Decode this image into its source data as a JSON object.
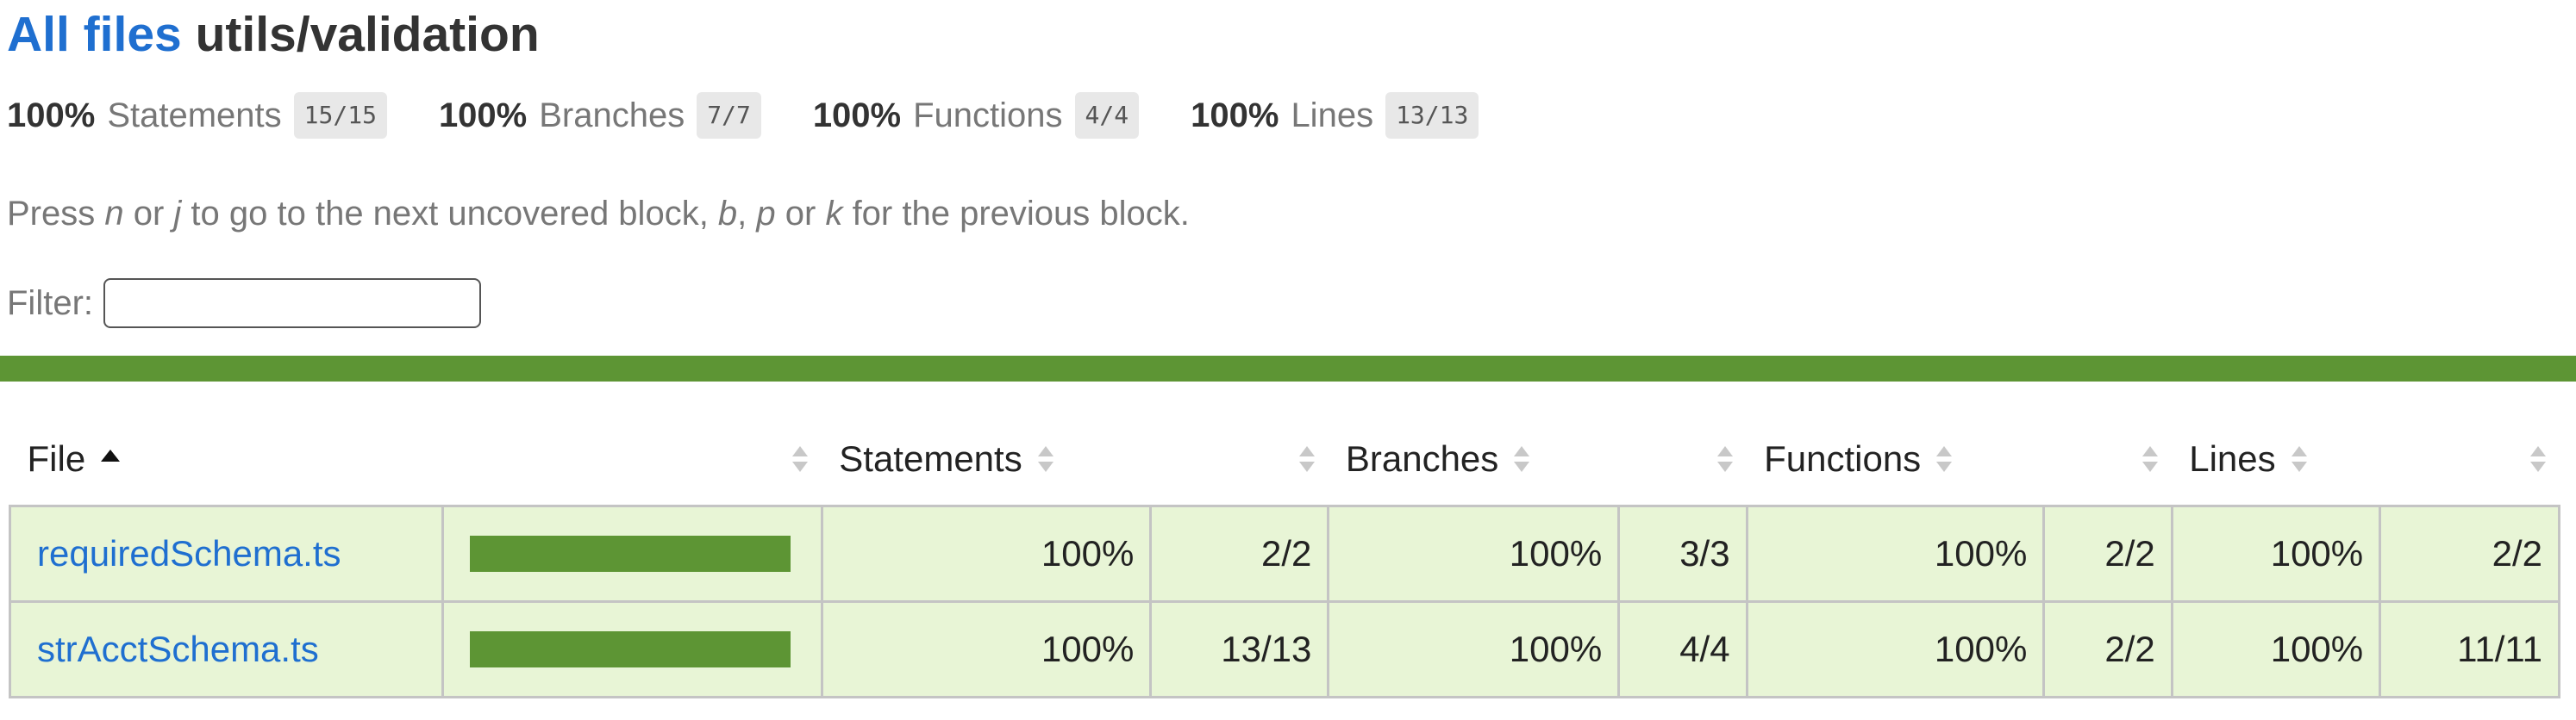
{
  "header": {
    "all_files_link": "All files",
    "path": "utils/validation"
  },
  "summary": [
    {
      "pct": "100%",
      "label": "Statements",
      "fraction": "15/15"
    },
    {
      "pct": "100%",
      "label": "Branches",
      "fraction": "7/7"
    },
    {
      "pct": "100%",
      "label": "Functions",
      "fraction": "4/4"
    },
    {
      "pct": "100%",
      "label": "Lines",
      "fraction": "13/13"
    }
  ],
  "help": {
    "t1": "Press ",
    "k1": "n",
    "t2": " or ",
    "k2": "j",
    "t3": " to go to the next uncovered block, ",
    "k3": "b",
    "t4": ", ",
    "k4": "p",
    "t5": " or ",
    "k5": "k",
    "t6": " for the previous block."
  },
  "filter": {
    "label": "Filter:",
    "value": "",
    "placeholder": ""
  },
  "status_color": "#5d9534",
  "table": {
    "headers": {
      "file": "File",
      "statements": "Statements",
      "branches": "Branches",
      "functions": "Functions",
      "lines": "Lines"
    },
    "rows": [
      {
        "file": "requiredSchema.ts",
        "coverage": 1.0,
        "statements_pct": "100%",
        "statements_frac": "2/2",
        "branches_pct": "100%",
        "branches_frac": "3/3",
        "functions_pct": "100%",
        "functions_frac": "2/2",
        "lines_pct": "100%",
        "lines_frac": "2/2"
      },
      {
        "file": "strAcctSchema.ts",
        "coverage": 1.0,
        "statements_pct": "100%",
        "statements_frac": "13/13",
        "branches_pct": "100%",
        "branches_frac": "4/4",
        "functions_pct": "100%",
        "functions_frac": "2/2",
        "lines_pct": "100%",
        "lines_frac": "11/11"
      }
    ]
  }
}
